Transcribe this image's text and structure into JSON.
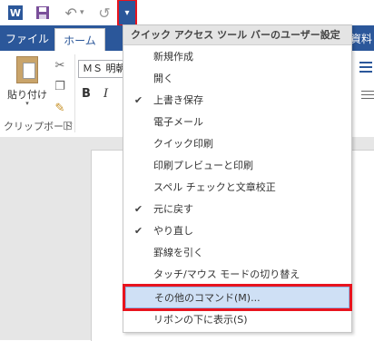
{
  "quick_access": {
    "app_icon_letter": "W",
    "undo_arrow": "↶",
    "undo_dropdown": "▾",
    "redo_arrow": "↺",
    "customize_arrow": "▾"
  },
  "ribbon_tabs": {
    "file": "ファイル",
    "home": "ホーム",
    "partial_right": "資料"
  },
  "ribbon": {
    "paste_label": "貼り付け",
    "paste_arrow": "▾",
    "clipboard_group": "クリップボード",
    "font_name": "ＭＳ 明朝",
    "bold": "B",
    "italic": "I"
  },
  "qa_menu": {
    "title": "クイック アクセス ツール バーのユーザー設定",
    "items": [
      {
        "label": "新規作成",
        "checked": ""
      },
      {
        "label": "開く",
        "checked": ""
      },
      {
        "label": "上書き保存",
        "checked": "✔"
      },
      {
        "label": "電子メール",
        "checked": ""
      },
      {
        "label": "クイック印刷",
        "checked": ""
      },
      {
        "label": "印刷プレビューと印刷",
        "checked": ""
      },
      {
        "label": "スペル チェックと文章校正",
        "checked": ""
      },
      {
        "label": "元に戻す",
        "checked": "✔"
      },
      {
        "label": "やり直し",
        "checked": "✔"
      },
      {
        "label": "罫線を引く",
        "checked": ""
      },
      {
        "label": "タッチ/マウス モードの切り替え",
        "checked": ""
      },
      {
        "label": "その他のコマンド(M)...",
        "checked": ""
      },
      {
        "label": "リボンの下に表示(S)",
        "checked": ""
      }
    ]
  },
  "colors": {
    "accent": "#2b579a",
    "highlight_fill": "#cfe0f5",
    "callout_red": "#e8141e"
  }
}
